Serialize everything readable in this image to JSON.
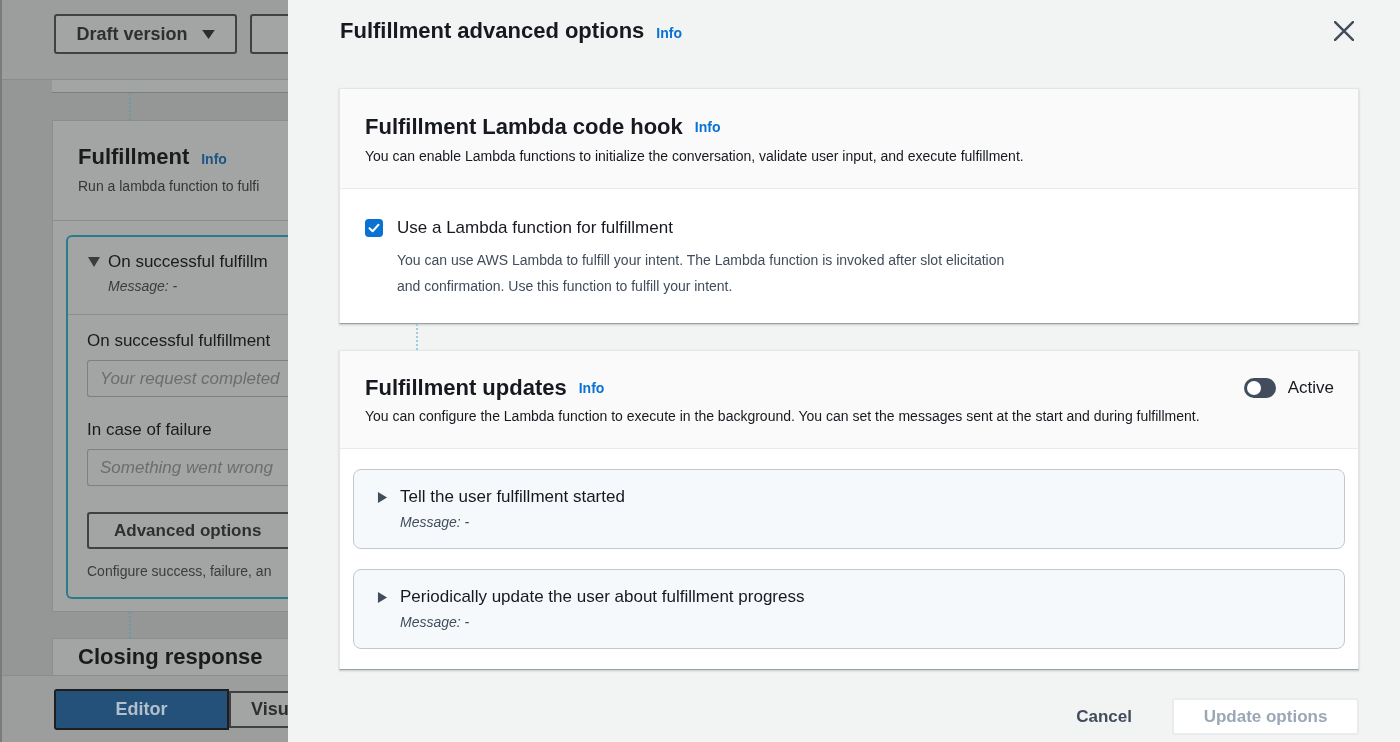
{
  "background_page": {
    "version_button": {
      "label": "Draft version"
    },
    "fulfillment_card": {
      "title": "Fulfillment",
      "info_link": "Info",
      "description": "Run a lambda function to fulfi",
      "success_response": {
        "title": "On successful fulfillm",
        "message": "Message: -",
        "expanded": true
      },
      "fields": [
        {
          "label": "On successful fulfillment",
          "placeholder": "Your request completed"
        },
        {
          "label": "In case of failure",
          "placeholder": "Something went wrong"
        }
      ],
      "advanced_button": "Advanced options",
      "hint": "Configure success, failure, an"
    },
    "next_card": {
      "title": "Closing response"
    },
    "mode_tabs": [
      {
        "label": "Editor",
        "selected": true
      },
      {
        "label": "Visu",
        "selected": false
      }
    ]
  },
  "panel": {
    "title": "Fulfillment advanced options",
    "info_link": "Info"
  },
  "code_hook": {
    "title": "Fulfillment Lambda code hook",
    "info_link": "Info",
    "description": "You can enable Lambda functions to initialize the conversation, validate user input, and execute fulfillment.",
    "option": {
      "label": "Use a Lambda function for fulfillment",
      "checked": true,
      "description": "You can use AWS Lambda to fulfill your intent. The Lambda function is invoked after slot elicitation and confirmation. Use this function to fulfill your intent."
    }
  },
  "updates": {
    "title": "Fulfillment updates",
    "info_link": "Info",
    "toggle": {
      "label": "Active",
      "on": false
    },
    "description": "You can configure the Lambda function to execute in the background. You can set the messages sent at the start and during fulfillment.",
    "messages": [
      {
        "title": "Tell the user fulfillment started",
        "message": "Message: -",
        "expanded": false
      },
      {
        "title": "Periodically update the user about fulfillment progress",
        "message": "Message: -",
        "expanded": false
      }
    ]
  },
  "footer": {
    "buttons": [
      {
        "label": "Cancel",
        "kind": "link",
        "disabled": false
      },
      {
        "label": "Update options",
        "kind": "button",
        "disabled": true
      }
    ]
  }
}
